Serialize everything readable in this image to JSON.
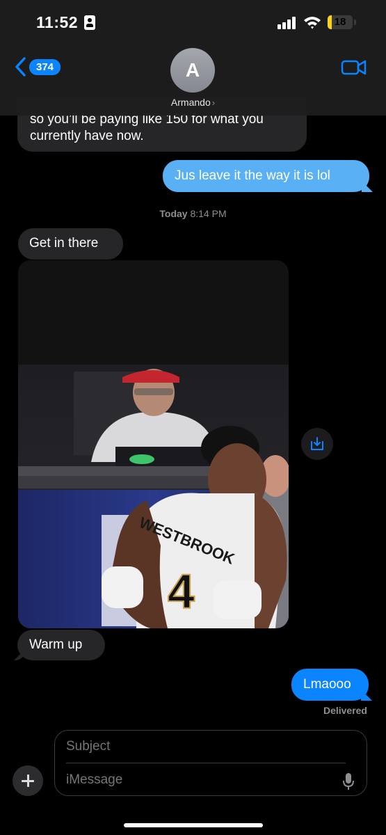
{
  "status_bar": {
    "time": "11:52",
    "battery": "18",
    "battery_level": 0.18
  },
  "header": {
    "back_count": "374",
    "avatar_initial": "A",
    "contact_name": "Armando",
    "contact_chevron": "›"
  },
  "messages": [
    {
      "text": "so you’ll be paying like 150 for what you currently have now.",
      "sender": "contact"
    },
    {
      "text": "Jus leave it the way it is lol",
      "sender": "me"
    },
    {
      "text": "Get in there",
      "sender": "contact"
    },
    {
      "text": "Warm up",
      "sender": "contact"
    },
    {
      "text": "Lmaooo",
      "sender": "me"
    }
  ],
  "timestamp": {
    "day": "Today",
    "time": "8:14 PM"
  },
  "delivery_status": "Delivered",
  "photo": {
    "jersey_name": "WESTBROOK",
    "jersey_number": "4"
  },
  "composer": {
    "subject_placeholder": "Subject",
    "message_placeholder": "iMessage"
  },
  "colors": {
    "sent_bubble": "#0a84ff",
    "received_bubble": "#262628",
    "background": "#000000",
    "battery": "#ffd60a"
  },
  "icons": [
    "id-card-icon",
    "signal-icon",
    "wifi-icon",
    "battery-icon",
    "back-chevron-icon",
    "video-call-icon",
    "save-photo-icon",
    "plus-icon",
    "microphone-icon"
  ]
}
